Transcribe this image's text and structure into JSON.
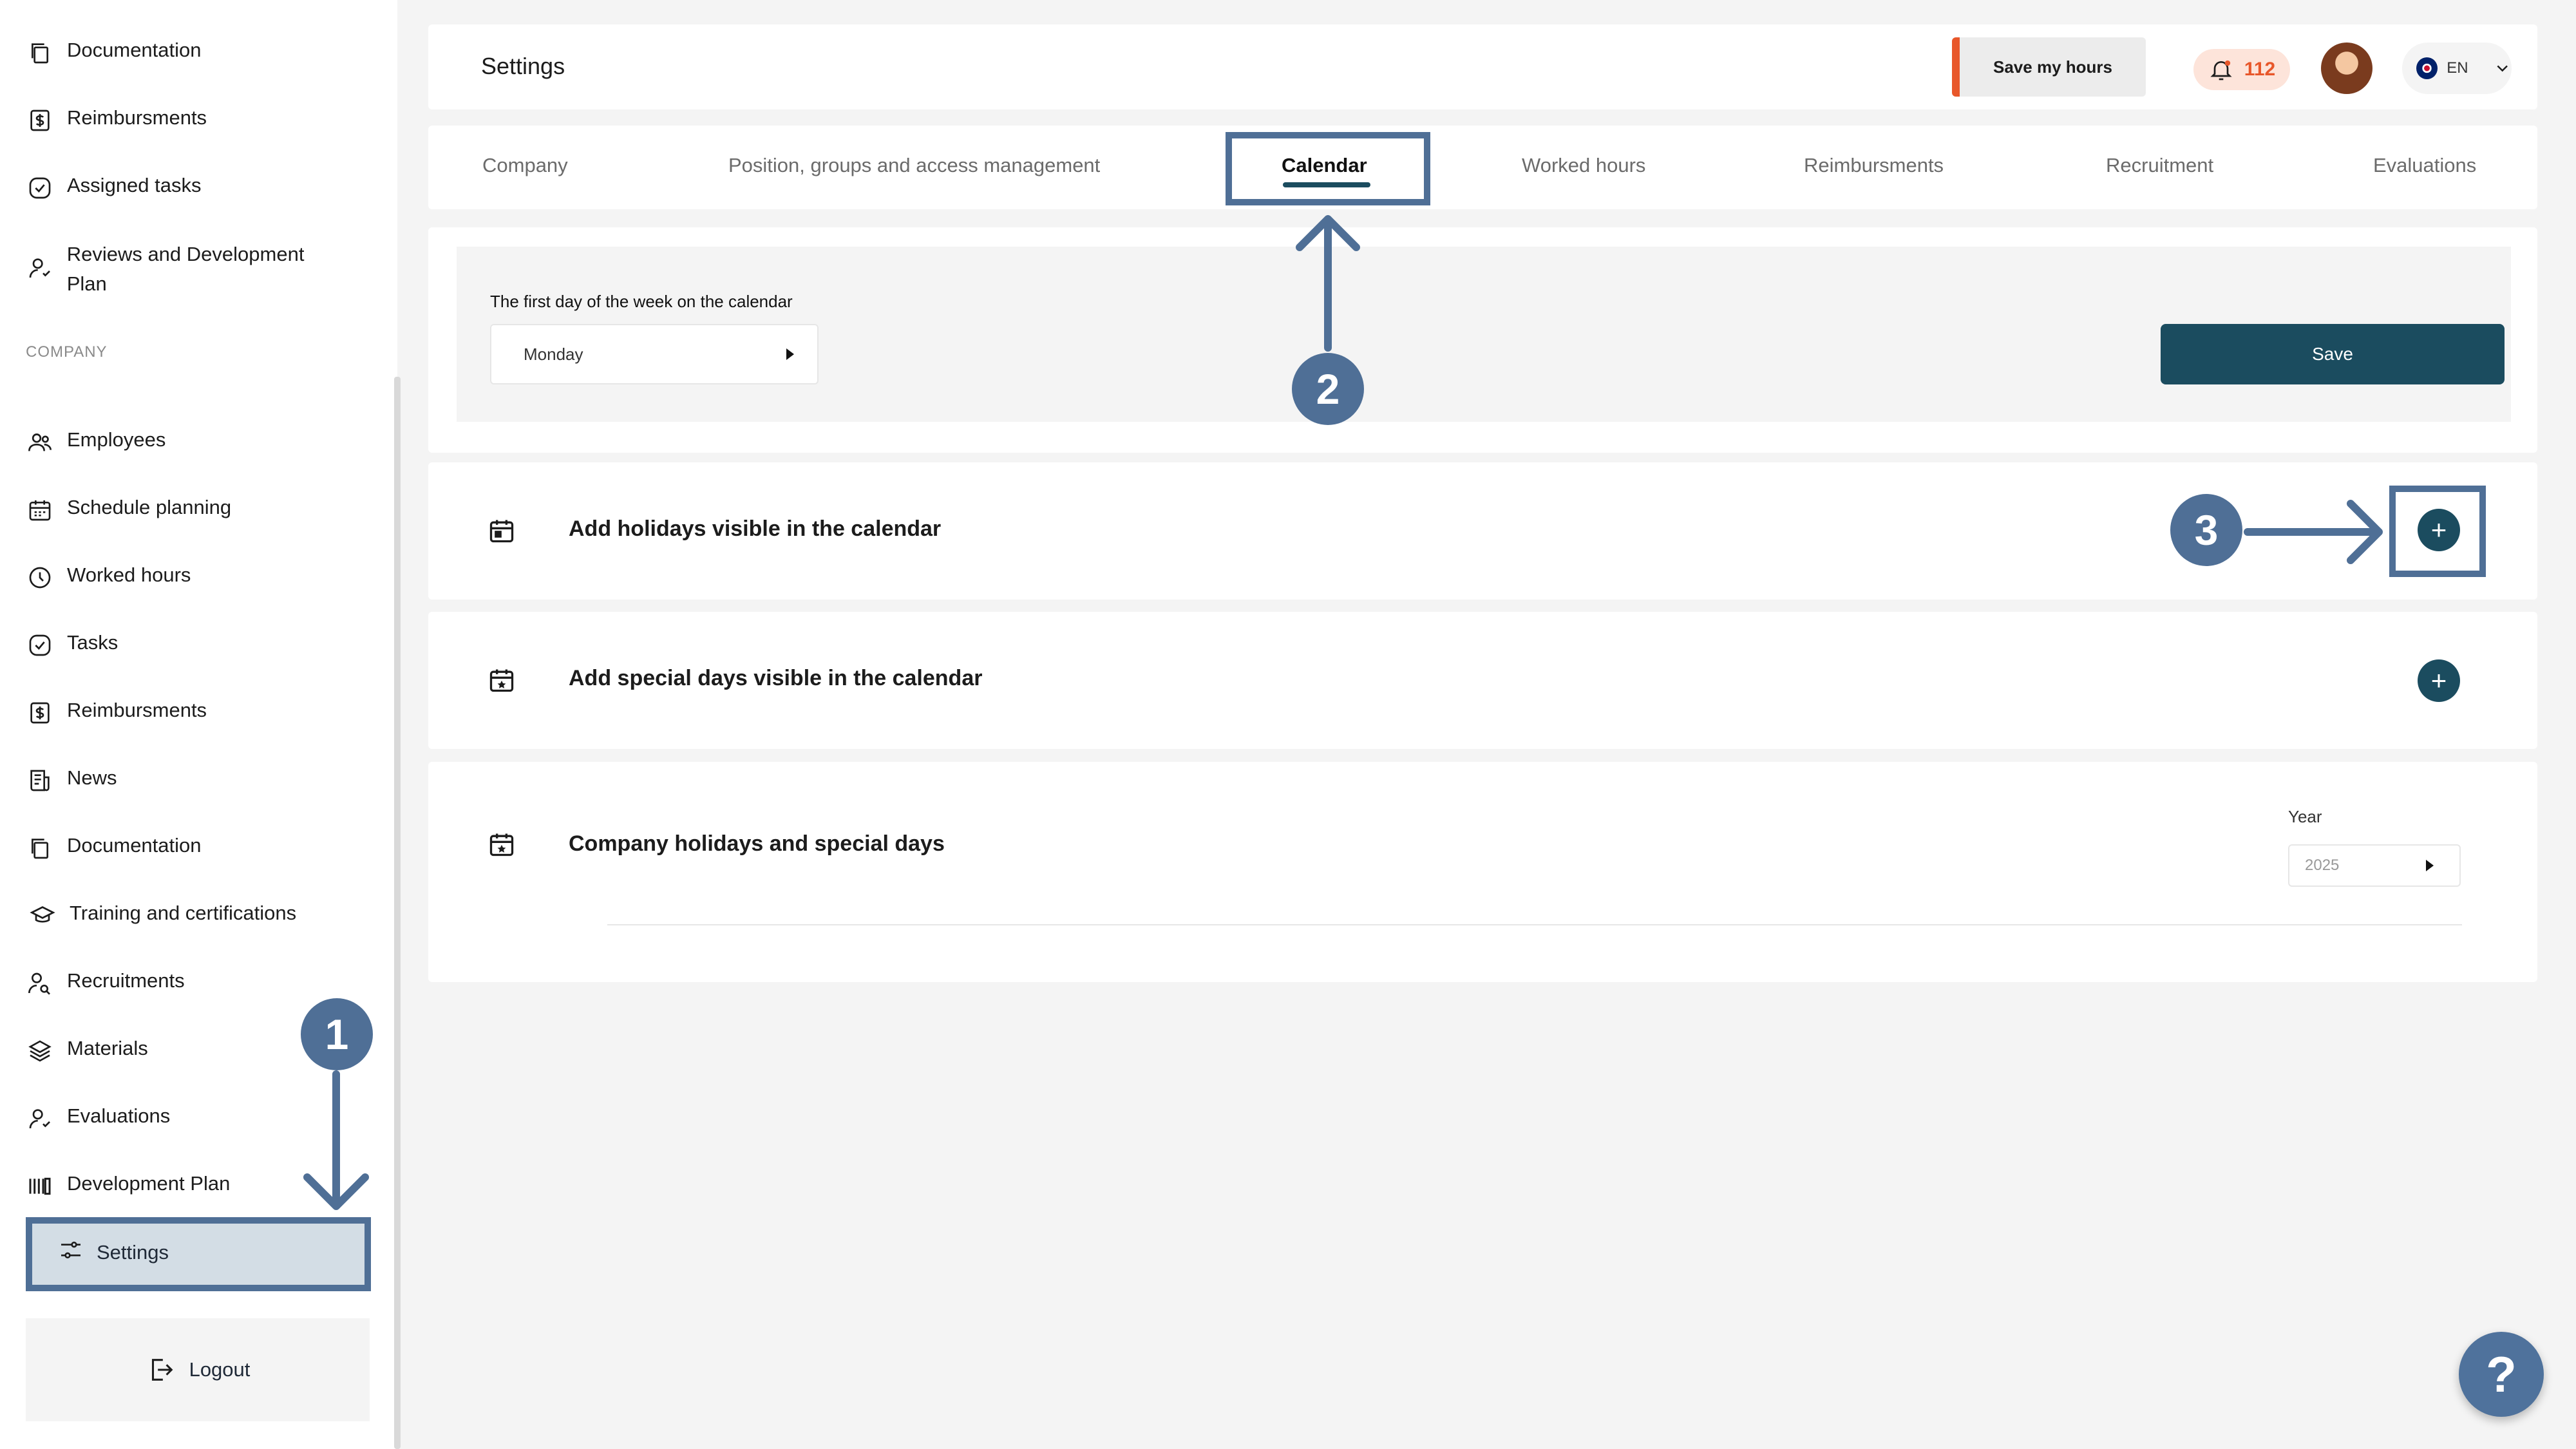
{
  "sidebar": {
    "items_top": [
      {
        "label": "Documentation",
        "icon": "documents-icon"
      },
      {
        "label": "Reimbursments",
        "icon": "dollar-icon"
      },
      {
        "label": "Assigned tasks",
        "icon": "check-circle-icon"
      },
      {
        "label": "Reviews and Development Plan",
        "icon": "person-star-icon"
      }
    ],
    "section_label": "COMPANY",
    "items_company": [
      {
        "label": "Employees",
        "icon": "people-icon"
      },
      {
        "label": "Schedule planning",
        "icon": "calendar-grid-icon"
      },
      {
        "label": "Worked hours",
        "icon": "clock-icon"
      },
      {
        "label": "Tasks",
        "icon": "check-circle-icon"
      },
      {
        "label": "Reimbursments",
        "icon": "dollar-icon"
      },
      {
        "label": "News",
        "icon": "news-icon"
      },
      {
        "label": "Documentation",
        "icon": "documents-icon"
      },
      {
        "label": "Training and certifications",
        "icon": "graduation-cap-icon"
      },
      {
        "label": "Recruitments",
        "icon": "person-search-icon"
      },
      {
        "label": "Materials",
        "icon": "layers-icon"
      },
      {
        "label": "Evaluations",
        "icon": "person-star-icon"
      },
      {
        "label": "Development Plan",
        "icon": "bars-icon"
      }
    ],
    "settings_label": "Settings",
    "logout_label": "Logout"
  },
  "header": {
    "title": "Settings",
    "save_hours_label": "Save my hours",
    "notification_count": "112",
    "language": "EN"
  },
  "tabs": [
    {
      "label": "Company"
    },
    {
      "label": "Position, groups and access management"
    },
    {
      "label": "Calendar"
    },
    {
      "label": "Worked hours"
    },
    {
      "label": "Reimbursments"
    },
    {
      "label": "Recruitment"
    },
    {
      "label": "Evaluations"
    }
  ],
  "calendar": {
    "week_label": "The first day of the week on the calendar",
    "week_value": "Monday",
    "save_label": "Save",
    "holidays_title": "Add holidays visible in the calendar",
    "special_days_title": "Add special days visible in the calendar",
    "company_days_title": "Company holidays and special days",
    "year_label": "Year",
    "year_value": "2025"
  },
  "annotations": {
    "step1": "1",
    "step2": "2",
    "step3": "3"
  },
  "help_label": "?",
  "colors": {
    "primary": "#1b4c5f",
    "accent": "#e8572a",
    "annotation": "#4f6f96"
  }
}
